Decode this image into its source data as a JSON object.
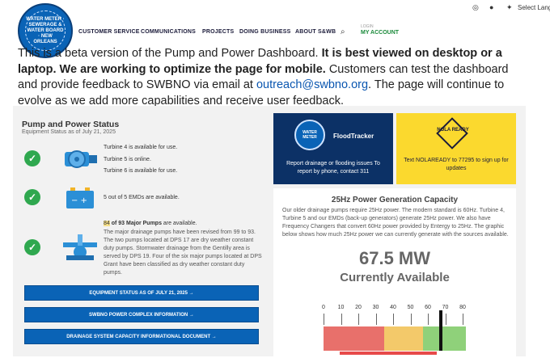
{
  "header": {
    "logo_text": "WATER METER · SEWERAGE & WATER BOARD · NEW ORLEANS",
    "language": "Select Langu",
    "nav": [
      "CUSTOMER SERVICE",
      "COMMUNICATIONS",
      "PROJECTS",
      "DOING BUSINESS",
      "ABOUT S&WB"
    ],
    "account_small": "LOGIN",
    "account": "MY ACCOUNT"
  },
  "intro": {
    "p1": "This is a beta version of the Pump and Power Dashboard. ",
    "p1_bold": "It is best viewed on desktop or a laptop. We are working to optimize the page for mobile.",
    "p2": " Customers can test the dashboard and provide feedback to SWBNO via email at ",
    "email": "outreach@swbno.org",
    "p3": ". The page will continue to evolve as we add more capabilities and receive user feedback."
  },
  "pump_power": {
    "title": "Pump and Power Status",
    "subtitle": "Equipment Status as of July 21, 2025",
    "turbines": [
      "Turbine 4 is available for use.",
      "Turbine 5 is online.",
      "Turbine 6 is available for use."
    ],
    "emds": "5 out of 5 EMDs are available.",
    "pumps_count": "84",
    "pumps_total": " of 93 Major Pumps",
    "pumps_suffix": " are available.",
    "pumps_detail": "The major drainage pumps have been revised from 99 to 93. The two pumps located at DPS 17 are dry weather constant duty pumps. Stormwater drainage from the Gentilly area is served by DPS 19. Four of the six major pumps located at DPS Grant have been classified as dry weather constant duty pumps.",
    "buttons": [
      "EQUIPMENT STATUS AS OF JULY 21, 2025 →",
      "SWBNO POWER COMPLEX INFORMATION →",
      "DRAINAGE SYSTEM CAPACITY INFORMATIONAL DOCUMENT →"
    ]
  },
  "floodtracker": {
    "logo_text": "WATER METER",
    "title": "FloodTracker",
    "desc": "Report drainage or flooding issues To report by phone, contact 311"
  },
  "nolaready": {
    "badge": "NOLA READY",
    "desc": "Text NOLAREADY to 77295 to sign up for updates"
  },
  "generation": {
    "title": "25Hz Power Generation Capacity",
    "text": "Our older drainage pumps require 25Hz power. The modern standard is 60Hz. Turbine 4, Turbine 5 and our EMDs (back-up generators) generate 25Hz power. We also have Frequency Changers that convert 60Hz power provided by Entergy to 25Hz. The graphic below shows how much 25Hz power we can currently generate with the sources available.",
    "value": "67.5 MW",
    "status": "Currently Available",
    "ticks": [
      "0",
      "10",
      "20",
      "30",
      "40",
      "50",
      "60",
      "70",
      "80"
    ],
    "gauge_value": 67.5,
    "colors": {
      "red": "#e8706b",
      "yellow": "#f3c96a",
      "green": "#8fd17a"
    }
  }
}
